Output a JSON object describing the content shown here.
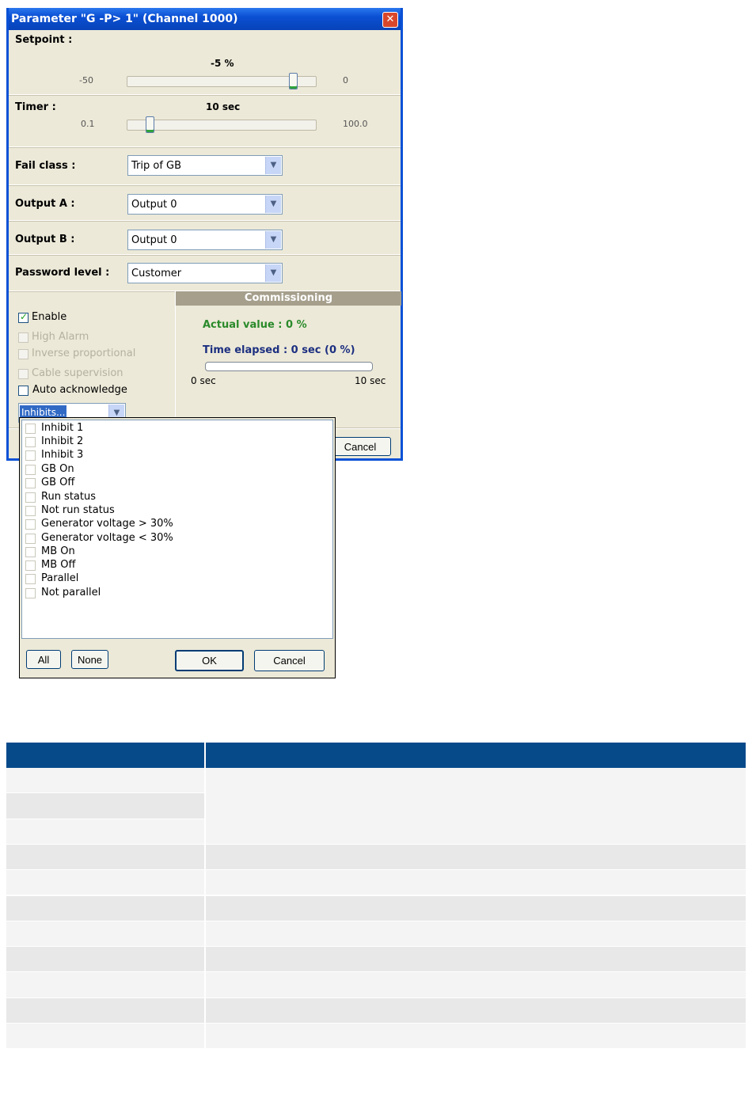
{
  "dialog": {
    "title": "Parameter \"G  -P>      1\" (Channel 1000)",
    "close_glyph": "✕",
    "setpoint": {
      "label": "Setpoint :",
      "value": "-5 %",
      "min": "-50",
      "max": "0",
      "fraction": 0.9
    },
    "timer": {
      "label": "Timer :",
      "value": "10 sec",
      "min": "0.1",
      "max": "100.0",
      "fraction": 0.1
    },
    "fail_class": {
      "label": "Fail class :",
      "value": "Trip of GB"
    },
    "output_a": {
      "label": "Output A :",
      "value": "Output 0"
    },
    "output_b": {
      "label": "Output B :",
      "value": "Output 0"
    },
    "password_level": {
      "label": "Password level :",
      "value": "Customer"
    },
    "checkboxes": [
      {
        "label": "Enable",
        "checked": true,
        "enabled": true
      },
      {
        "label": "High Alarm",
        "checked": false,
        "enabled": false
      },
      {
        "label": "Inverse proportional",
        "checked": false,
        "enabled": false
      },
      {
        "label": "Cable supervision",
        "checked": false,
        "enabled": false
      },
      {
        "label": "Auto acknowledge",
        "checked": false,
        "enabled": true
      }
    ],
    "inhibits_combo": "Inhibits...",
    "commissioning": {
      "header": "Commissioning",
      "actual_value": "Actual value : 0 %",
      "time_elapsed": "Time elapsed : 0 sec (0 %)",
      "progress": 0,
      "progress_min": "0 sec",
      "progress_max": "10 sec"
    },
    "cancel_button": "Cancel",
    "combo_arrow": "▼",
    "check_glyph": "✓"
  },
  "inhibits_popup": {
    "items": [
      "Inhibit 1",
      "Inhibit 2",
      "Inhibit 3",
      "GB On",
      "GB Off",
      "Run status",
      "Not run status",
      "Generator voltage > 30%",
      "Generator voltage < 30%",
      "MB On",
      "MB Off",
      "Parallel",
      "Not parallel"
    ],
    "buttons": {
      "all": "All",
      "none": "None",
      "ok": "OK",
      "cancel": "Cancel"
    }
  },
  "table": {
    "colors": {
      "header": "#064a8a",
      "row_light": "#f4f4f4",
      "row_dark": "#e8e8e8"
    }
  }
}
